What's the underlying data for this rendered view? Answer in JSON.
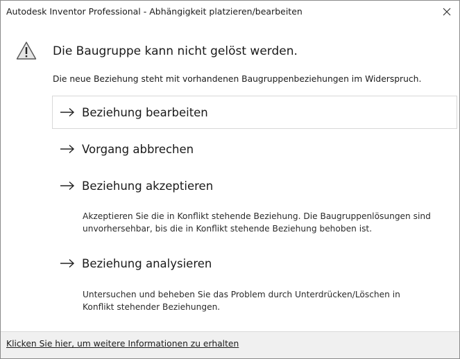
{
  "window": {
    "title": "Autodesk Inventor Professional - Abhängigkeit platzieren/bearbeiten",
    "close_icon": "close-icon"
  },
  "dialog": {
    "icon": "warning-icon",
    "main_instruction": "Die Baugruppe kann nicht gelöst werden.",
    "content": "Die neue Beziehung steht mit vorhandenen Baugruppenbeziehungen im Widerspruch."
  },
  "commands": [
    {
      "label": "Beziehung bearbeiten",
      "icon": "arrow-right-icon"
    },
    {
      "label": "Vorgang abbrechen",
      "icon": "arrow-right-icon"
    },
    {
      "label": "Beziehung akzeptieren",
      "icon": "arrow-right-icon",
      "note_line1": "Akzeptieren Sie die in Konflikt stehende Beziehung. Die Baugruppenlösungen sind",
      "note_line2": "unvorhersehbar, bis die in Konflikt stehende Beziehung behoben ist."
    },
    {
      "label": "Beziehung analysieren",
      "icon": "arrow-right-icon",
      "note_line1": "Untersuchen und beheben Sie das Problem durch Unterdrücken/Löschen in",
      "note_line2": "Konflikt stehender Beziehungen."
    }
  ],
  "footer": {
    "link": "Klicken Sie hier, um weitere Informationen zu erhalten"
  },
  "colors": {
    "border": "#8a8a8a",
    "footer_bg": "#f0f0f0",
    "hover_border": "#d8d8d8"
  }
}
